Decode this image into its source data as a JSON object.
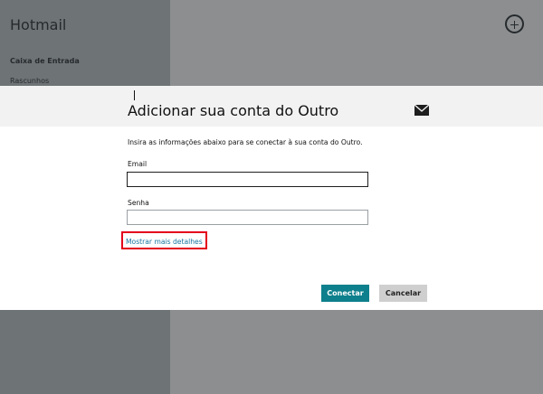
{
  "app": {
    "title": "Hotmail"
  },
  "sidebar": {
    "folders": [
      {
        "label": "Caixa de Entrada"
      },
      {
        "label": "Rascunhos"
      }
    ]
  },
  "dialog": {
    "title": "Adicionar sua conta do Outro",
    "instructions": "Insira as informações abaixo para se conectar à sua conta do Outro.",
    "email_label": "Email",
    "email_value": "",
    "password_label": "Senha",
    "password_value": "",
    "details_link": "Mostrar mais detalhes",
    "connect_label": "Conectar",
    "cancel_label": "Cancelar"
  },
  "colors": {
    "accent": "#0e7f8c",
    "link": "#1874a0",
    "highlight": "#e3001b"
  },
  "icons": {
    "header_action": "add-circle-icon",
    "dialog": "mail-icon"
  }
}
